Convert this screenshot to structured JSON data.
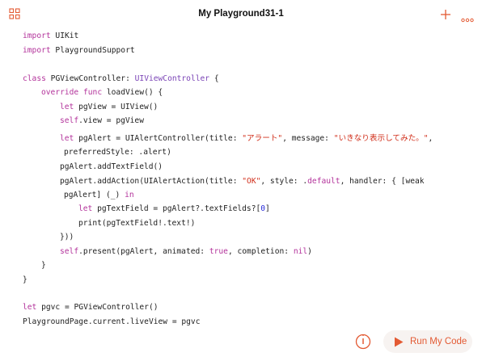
{
  "header": {
    "title": "My Playground31-1",
    "left_icon": "grid-icon",
    "right_icons": [
      "add-icon",
      "more-icon"
    ]
  },
  "code": {
    "line1": {
      "a": "import",
      "b": " UIKit"
    },
    "line2": {
      "a": "import",
      "b": " PlaygroundSupport"
    },
    "line3": {
      "a": "class",
      "b": " PGViewController: ",
      "c": "UIViewController",
      "d": " {"
    },
    "line4": {
      "a": "override",
      "b": " ",
      "c": "func",
      "d": " loadView() {"
    },
    "line5": {
      "a": "let",
      "b": " pgView = UIView()"
    },
    "line6": {
      "a": "self",
      "b": ".view = pgView"
    },
    "line7": {
      "a": "let",
      "b": " pgAlert = UIAlertController(title: ",
      "c": "\"アラート\"",
      "d": ", message: ",
      "e": "\"いきなり表示してみた。\"",
      "f": ","
    },
    "line8": {
      "a": "preferredStyle: .alert)"
    },
    "line9": {
      "a": "pgAlert.addTextField()"
    },
    "line10": {
      "a": "pgAlert.addAction(UIAlertAction(title: ",
      "b": "\"OK\"",
      "c": ", style: .",
      "d": "default",
      "e": ", handler: { [weak"
    },
    "line11": {
      "a": "pgAlert] (_) ",
      "b": "in"
    },
    "line12": {
      "a": "let",
      "b": " pgTextField = pgAlert?.textFields?[",
      "c": "0",
      "d": "]"
    },
    "line13": {
      "a": "print(pgTextField!.text!)"
    },
    "line14": {
      "a": "}))"
    },
    "line15": {
      "a": "self",
      "b": ".present(pgAlert, animated: ",
      "c": "true",
      "d": ", completion: ",
      "e": "nil",
      "f": ")"
    },
    "line16": {
      "a": "}"
    },
    "line17": {
      "a": "}"
    },
    "line18": {
      "a": "let",
      "b": " pgvc = PGViewController()"
    },
    "line19": {
      "a": "PlaygroundPage.current.liveView = pgvc"
    }
  },
  "footer": {
    "info_icon": "info-icon",
    "run_label": "Run My Code",
    "run_icon": "play-icon"
  },
  "colors": {
    "accent": "#e35a33",
    "keyword": "#b3339b",
    "type": "#7a43b6",
    "string": "#d12f1b",
    "number": "#272ad8"
  }
}
